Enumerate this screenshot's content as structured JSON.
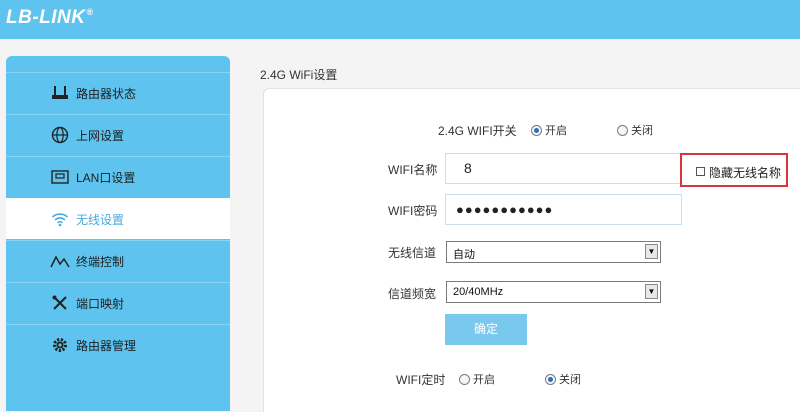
{
  "brand": {
    "logo_text": "LB-LINK",
    "reg_mark": "®"
  },
  "sidebar": {
    "items": [
      {
        "label": "路由器状态",
        "icon": "router-icon",
        "active": false
      },
      {
        "label": "上网设置",
        "icon": "globe-icon",
        "active": false
      },
      {
        "label": "LAN口设置",
        "icon": "lan-port-icon",
        "active": false
      },
      {
        "label": "无线设置",
        "icon": "wifi-icon",
        "active": true
      },
      {
        "label": "终端控制",
        "icon": "signal-wave-icon",
        "active": false
      },
      {
        "label": "端口映射",
        "icon": "tools-icon",
        "active": false
      },
      {
        "label": "路由器管理",
        "icon": "gear-icon",
        "active": false
      }
    ]
  },
  "page": {
    "title": "2.4G WiFi设置"
  },
  "form": {
    "wifi_switch": {
      "label": "2.4G WIFI开关",
      "on_label": "开启",
      "off_label": "关闭",
      "selected": "开启"
    },
    "ssid": {
      "label": "WIFI名称",
      "value": "8"
    },
    "hide_ssid": {
      "label": "隐藏无线名称",
      "checked": false
    },
    "password": {
      "label": "WIFI密码",
      "value": "●●●●●●●●●●●"
    },
    "channel": {
      "label": "无线信道",
      "value": "自动"
    },
    "bandwidth": {
      "label": "信道频宽",
      "value": "20/40MHz"
    },
    "confirm_label": "确定",
    "schedule": {
      "label": "WIFI定时",
      "on_label": "开启",
      "off_label": "关闭",
      "selected": "关闭"
    }
  },
  "colors": {
    "header": "#5ec3ee",
    "sidebar": "#5ec3ee",
    "active_text": "#4aa9dc",
    "highlight_border": "#d9343b",
    "button": "#79c9ee"
  }
}
